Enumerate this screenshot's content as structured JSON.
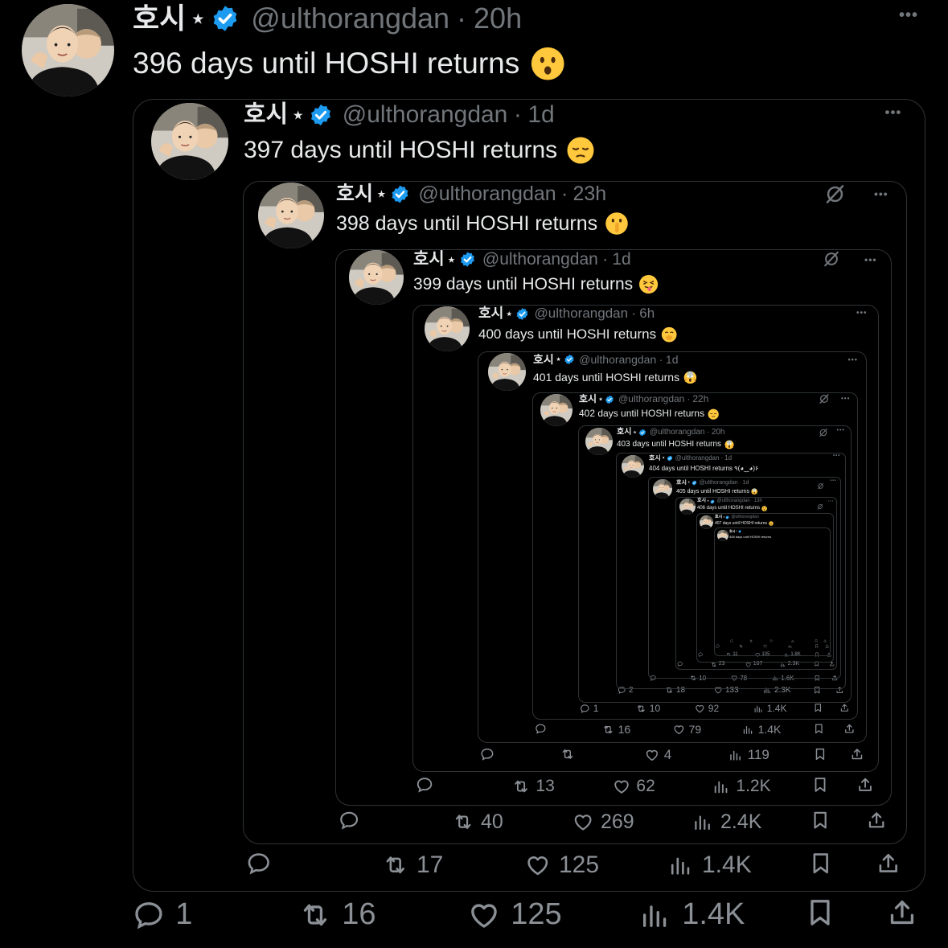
{
  "colors": {
    "background": "#000000",
    "text": "#e7e9ea",
    "muted": "#71767b",
    "verified": "#1d9bf0",
    "border": "#2f3336"
  },
  "tweets": [
    {
      "name": "호시",
      "star": "⭑",
      "handle": "@ulthorangdan",
      "sep": "·",
      "time": "20h",
      "text": "396 days until HOSHI returns",
      "emoji": "hushed-face",
      "actions": {
        "reply": "1",
        "retweet": "16",
        "like": "125",
        "views": "1.4K"
      }
    },
    {
      "name": "호시",
      "star": "⭑",
      "handle": "@ulthorangdan",
      "sep": "·",
      "time": "1d",
      "text": "397 days until HOSHI returns",
      "emoji": "pensive-face",
      "actions": {
        "reply": "",
        "retweet": "17",
        "like": "125",
        "views": "1.4K"
      }
    },
    {
      "name": "호시",
      "star": "⭑",
      "handle": "@ulthorangdan",
      "sep": "·",
      "time": "23h",
      "text": "398 days until HOSHI returns",
      "emoji": "shushing-face",
      "actions": {
        "reply": "",
        "retweet": "40",
        "like": "269",
        "views": "2.4K"
      }
    },
    {
      "name": "호시",
      "star": "⭑",
      "handle": "@ulthorangdan",
      "sep": "·",
      "time": "1d",
      "text": "399 days until HOSHI returns",
      "emoji": "tongue-face",
      "actions": {
        "reply": "",
        "retweet": "13",
        "like": "62",
        "views": "1.2K"
      }
    },
    {
      "name": "호시",
      "star": "⭑",
      "handle": "@ulthorangdan",
      "sep": "·",
      "time": "6h",
      "text": "400 days until HOSHI returns",
      "emoji": "hand-over-mouth-face",
      "actions": {
        "reply": "",
        "retweet": "",
        "like": "4",
        "views": "119"
      }
    },
    {
      "name": "호시",
      "star": "⭑",
      "handle": "@ulthorangdan",
      "sep": "·",
      "time": "1d",
      "text": "401 days until HOSHI returns",
      "emoji": "screaming-face",
      "actions": {
        "reply": "",
        "retweet": "16",
        "like": "79",
        "views": "1.4K"
      }
    },
    {
      "name": "호시",
      "star": "⭑",
      "handle": "@ulthorangdan",
      "sep": "·",
      "time": "22h",
      "text": "402 days until HOSHI returns",
      "emoji": "pensive-face",
      "actions": {
        "reply": "1",
        "retweet": "10",
        "like": "92",
        "views": "1.4K"
      }
    },
    {
      "name": "호시",
      "star": "⭑",
      "handle": "@ulthorangdan",
      "sep": "·",
      "time": "20h",
      "text": "403 days until HOSHI returns",
      "emoji": "screaming-face",
      "actions": {
        "reply": "2",
        "retweet": "18",
        "like": "133",
        "views": "2.3K"
      }
    },
    {
      "name": "호시",
      "star": "⭑",
      "handle": "@ulthorangdan",
      "sep": "·",
      "time": "1d",
      "text": "404 days until HOSHI returns ٩(◕‿◕)۶",
      "emoji": "",
      "actions": {
        "reply": "",
        "retweet": "10",
        "like": "78",
        "views": "1.6K"
      }
    },
    {
      "name": "호시",
      "star": "⭑",
      "handle": "@ulthorangdan",
      "sep": "·",
      "time": "1d",
      "text": "405 days until HOSHI returns",
      "emoji": "screaming-face",
      "actions": {
        "reply": "",
        "retweet": "23",
        "like": "167",
        "views": "2.3K"
      }
    },
    {
      "name": "호시",
      "star": "⭑",
      "handle": "@ulthorangdan",
      "sep": "·",
      "time": "13h",
      "text": "406 days until HOSHI returns",
      "emoji": "hushed-face",
      "actions": {
        "reply": "",
        "retweet": "11",
        "like": "105",
        "views": "1.8K"
      }
    },
    {
      "name": "호시",
      "star": "⭑",
      "handle": "@ulthorangdan",
      "sep": "",
      "time": "",
      "text": "407 days until HOSHI returns",
      "emoji": "hushed-face",
      "actions": {
        "reply": "",
        "retweet": "",
        "like": "",
        "views": ""
      }
    },
    {
      "name": "호시",
      "star": "⭑",
      "handle": "",
      "sep": "",
      "time": "",
      "text": "408 days until HOSHI returns",
      "emoji": "",
      "actions": {
        "reply": "",
        "retweet": "",
        "like": "",
        "views": ""
      }
    }
  ],
  "more_icon": "•••",
  "icons": {
    "reply": "reply-icon",
    "retweet": "retweet-icon",
    "like": "heart-icon",
    "views": "views-icon",
    "bookmark": "bookmark-icon",
    "share": "share-icon",
    "grok": "grok-icon"
  }
}
